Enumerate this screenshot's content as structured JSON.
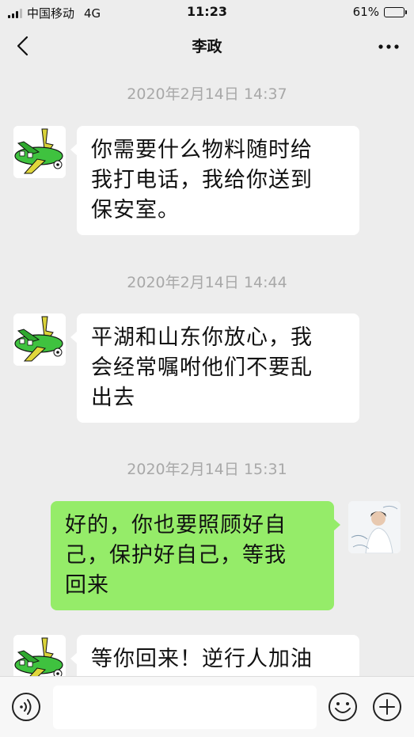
{
  "status_bar": {
    "carrier": "中国移动",
    "network": "4G",
    "time": "11:23",
    "battery_text": "61%",
    "battery_level": 0.61
  },
  "nav": {
    "title": "李政",
    "back_icon": "chevron-left-icon",
    "more_icon": "more-dots-icon"
  },
  "messages": [
    {
      "type": "timestamp",
      "text": "2020年2月14日 14:37"
    },
    {
      "type": "message",
      "side": "left",
      "lines": [
        "你需要什么物料随时给",
        "我打电话，我给你送到",
        "保安室。"
      ]
    },
    {
      "type": "timestamp",
      "text": "2020年2月14日 14:44"
    },
    {
      "type": "message",
      "side": "left",
      "lines": [
        "平湖和山东你放心，我",
        "会经常嘱咐他们不要乱",
        "出去"
      ]
    },
    {
      "type": "timestamp",
      "text": "2020年2月14日 15:31"
    },
    {
      "type": "message",
      "side": "right",
      "lines": [
        "好的，你也要照顾好自",
        "己，保护好自己，等我",
        "回来"
      ]
    },
    {
      "type": "message",
      "side": "left",
      "lines": [
        "等你回来！逆行人加油"
      ]
    }
  ],
  "input_bar": {
    "voice_icon": "voice-icon",
    "emoji_icon": "emoji-icon",
    "plus_icon": "plus-icon",
    "input_value": ""
  },
  "colors": {
    "background": "#ededed",
    "bubble_received": "#ffffff",
    "bubble_sent": "#95ec69",
    "timestamp": "#a8a8a8"
  }
}
